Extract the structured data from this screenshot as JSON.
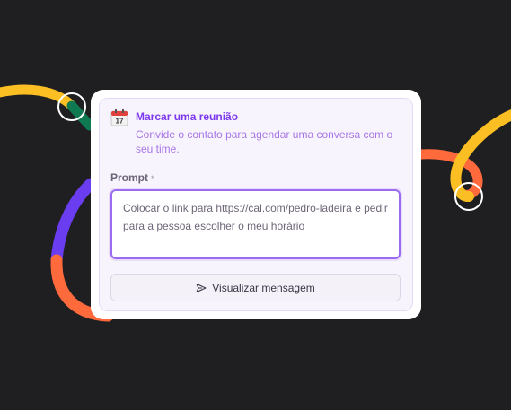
{
  "card": {
    "title": "Marcar uma reunião",
    "subtitle": "Convide o contato para agendar uma conversa com o seu time.",
    "icon": "calendar-icon",
    "prompt_label": "Prompt",
    "required_marker": "*",
    "prompt_value": "Colocar o link para https://cal.com/pedro-ladeira e pedir para a pessoa escolher o meu horário",
    "button_label": "Visualizar mensagem",
    "button_icon": "send-icon"
  },
  "colors": {
    "background": "#1f1f21",
    "accent": "#7c3aed",
    "subtitle": "#a776e6",
    "panel": "#f8f4fd",
    "curve_yellow": "#fbbf24",
    "curve_orange": "#ff6a3d",
    "curve_purple": "#6a3ef0",
    "curve_green": "#0f7a52"
  }
}
